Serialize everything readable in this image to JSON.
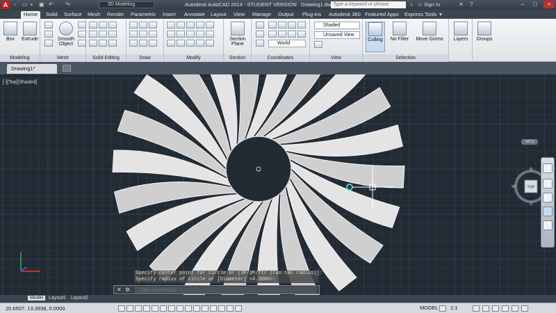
{
  "app": {
    "logo_letter": "A",
    "workspace": "3D Modeling",
    "title": "Autodesk AutoCAD 2014 - STUDENT VERSION",
    "filename": "Drawing1.dwg",
    "search_placeholder": "Type a keyword or phrase",
    "sign_in": "Sign In"
  },
  "ribbon_tabs": [
    "Home",
    "Solid",
    "Surface",
    "Mesh",
    "Render",
    "Parametric",
    "Insert",
    "Annotate",
    "Layout",
    "View",
    "Manage",
    "Output",
    "Plug-ins",
    "Autodesk 360",
    "Featured Apps",
    "Express Tools"
  ],
  "panels": {
    "modeling": {
      "label": "Modeling",
      "box": "Box",
      "extrude": "Extrude"
    },
    "mesh": {
      "label": "Mesh",
      "smooth": "Smooth Object"
    },
    "solid_editing": {
      "label": "Solid Editing"
    },
    "draw": {
      "label": "Draw"
    },
    "modify": {
      "label": "Modify"
    },
    "section": {
      "label": "Section",
      "plane": "Section Plane"
    },
    "coordinates": {
      "label": "Coordinates",
      "world": "World"
    },
    "view": {
      "label": "View",
      "visual_style": "Shaded",
      "named_view": "Unsaved View"
    },
    "selection": {
      "label": "Selection",
      "culling": "Culling",
      "filter": "No Filter",
      "gizmo": "Move Gizmo"
    },
    "layers": {
      "label": "Layers"
    },
    "groups": {
      "label": "Groups"
    }
  },
  "document_tab": "Drawing1*",
  "viewport_label": "[-][Top][Shaded]",
  "viewcube": {
    "n": "N",
    "s": "S",
    "e": "E",
    "w": "W",
    "face": "TOP",
    "wcs": "WCS"
  },
  "command": {
    "line1": "Specify center point for circle or [3P/2P/Ttr (tan tan radius)]:",
    "line2": "Specify radius of circle or [Diameter] <4.3086>:",
    "placeholder": "Type a command"
  },
  "layout_tabs": [
    "Model",
    "Layout1",
    "Layout2"
  ],
  "status": {
    "coords": "20.6507, 13.3938, 0.0000",
    "model": "MODEL",
    "scale": "1:1"
  }
}
